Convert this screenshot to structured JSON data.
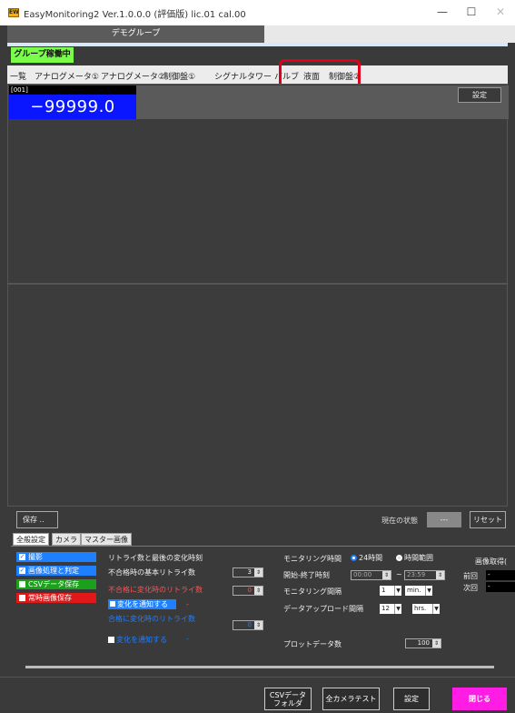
{
  "window": {
    "logo_text": "EW",
    "title": "EasyMonitoring2 Ver.1.0.0.0 (評価版) lic.01 cal.00",
    "minimize": "—",
    "maximize": "☐",
    "close": "✕"
  },
  "group": {
    "tab_label": "デモグループ",
    "status": "グループ稼働中"
  },
  "tabs": [
    "一覧",
    "アナログメータ①",
    "アナログメータ②",
    "制御盤①",
    "シグナルタワー",
    "バルブ",
    "液面",
    "制御盤②"
  ],
  "monitor": {
    "cell_id": "[001]",
    "cell_value": "−99999.0",
    "settings_label": "設定"
  },
  "toolbar": {
    "save_label": "保存 ..",
    "state_label": "現在の状態",
    "state_value": "---",
    "reset_label": "リセット"
  },
  "settings_tabs": [
    "全般設定",
    "カメラ",
    "マスター画像"
  ],
  "checkboxes": [
    {
      "label": "撮影",
      "checked": true,
      "color": "#1e7fff"
    },
    {
      "label": "画像処理と判定",
      "checked": true,
      "color": "#1e7fff"
    },
    {
      "label": "CSVデータ保存",
      "checked": false,
      "color": "#1aa01a"
    },
    {
      "label": "常時画像保存",
      "checked": false,
      "color": "#e01818"
    }
  ],
  "retry": {
    "title": "リトライ数と最後の変化時刻",
    "basic_label": "不合格時の基本リトライ数",
    "basic_value": "3",
    "change_label": "不合格に変化時のリトライ数",
    "change_value": "0",
    "notify1_label": "変化を通知する",
    "notify1_extra": "-",
    "pass_change_label": "合格に変化時のリトライ数",
    "pass_change_value": "0",
    "notify2_label": "変化を通知する",
    "notify2_extra": "-"
  },
  "monitoring": {
    "time_label": "モニタリング時間",
    "radio_24h": "24時間",
    "radio_range": "時間範囲",
    "start_end_label": "開始-終了時刻",
    "start_time": "00:00",
    "tilde": "~",
    "end_time": "23:59",
    "interval_label": "モニタリング間隔",
    "interval_value": "1",
    "interval_unit": "min.",
    "upload_label": "データアップロード間隔",
    "upload_value": "12",
    "upload_unit": "hrs.",
    "plot_label": "プロットデータ数",
    "plot_value": "100"
  },
  "image_capture": {
    "title": "画像取得(",
    "prev_label": "前回",
    "prev_value": "-",
    "next_label": "次回",
    "next_value": "-"
  },
  "footer": {
    "csv_line1": "CSVデータ",
    "csv_line2": "フォルダ",
    "camera_test": "全カメラテスト",
    "settings": "設定",
    "close": "閉じる"
  },
  "colors": {
    "accent_blue": "#1e7fff",
    "value_bg": "#0a16ff",
    "status_green": "#7cfc4a",
    "highlight_red": "#e0001a",
    "close_magenta": "#ff1de6"
  }
}
